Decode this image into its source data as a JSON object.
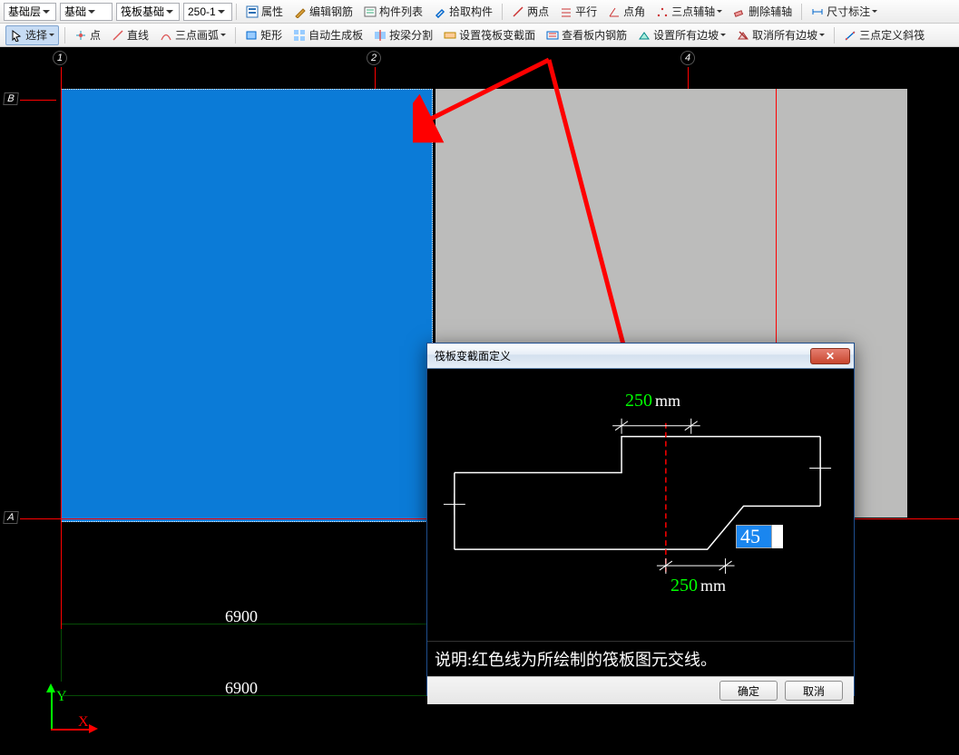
{
  "toolbar1": {
    "combo_layer": "基础层",
    "combo_cat": "基础",
    "combo_element": "筏板基础",
    "combo_size": "250-1",
    "attr": "属性",
    "edit_rebar": "编辑钢筋",
    "component_list": "构件列表",
    "pick_component": "拾取构件",
    "two_point": "两点",
    "parallel": "平行",
    "point_angle": "点角",
    "three_point_aux": "三点辅轴",
    "delete_aux": "删除辅轴",
    "dim_annotate": "尺寸标注"
  },
  "toolbar2": {
    "select": "选择",
    "point": "点",
    "line": "直线",
    "arc3": "三点画弧",
    "rect": "矩形",
    "auto_slab": "自动生成板",
    "split_beam": "按梁分割",
    "set_section": "设置筏板变截面",
    "view_rebar": "查看板内钢筋",
    "set_all_slope": "设置所有边坡",
    "cancel_slope": "取消所有边坡",
    "three_point_slope": "三点定义斜筏"
  },
  "grid": {
    "col1": "1",
    "col2": "2",
    "col4": "4",
    "rowA": "A",
    "rowB": "B"
  },
  "dims": {
    "d1": "6900",
    "d2": "6900"
  },
  "dialog": {
    "title": "筏板变截面定义",
    "top_dim": "250",
    "bottom_dim": "250",
    "unit": "mm",
    "angle_value": "45",
    "note": "说明:红色线为所绘制的筏板图元交线。",
    "ok": "确定",
    "cancel": "取消"
  }
}
